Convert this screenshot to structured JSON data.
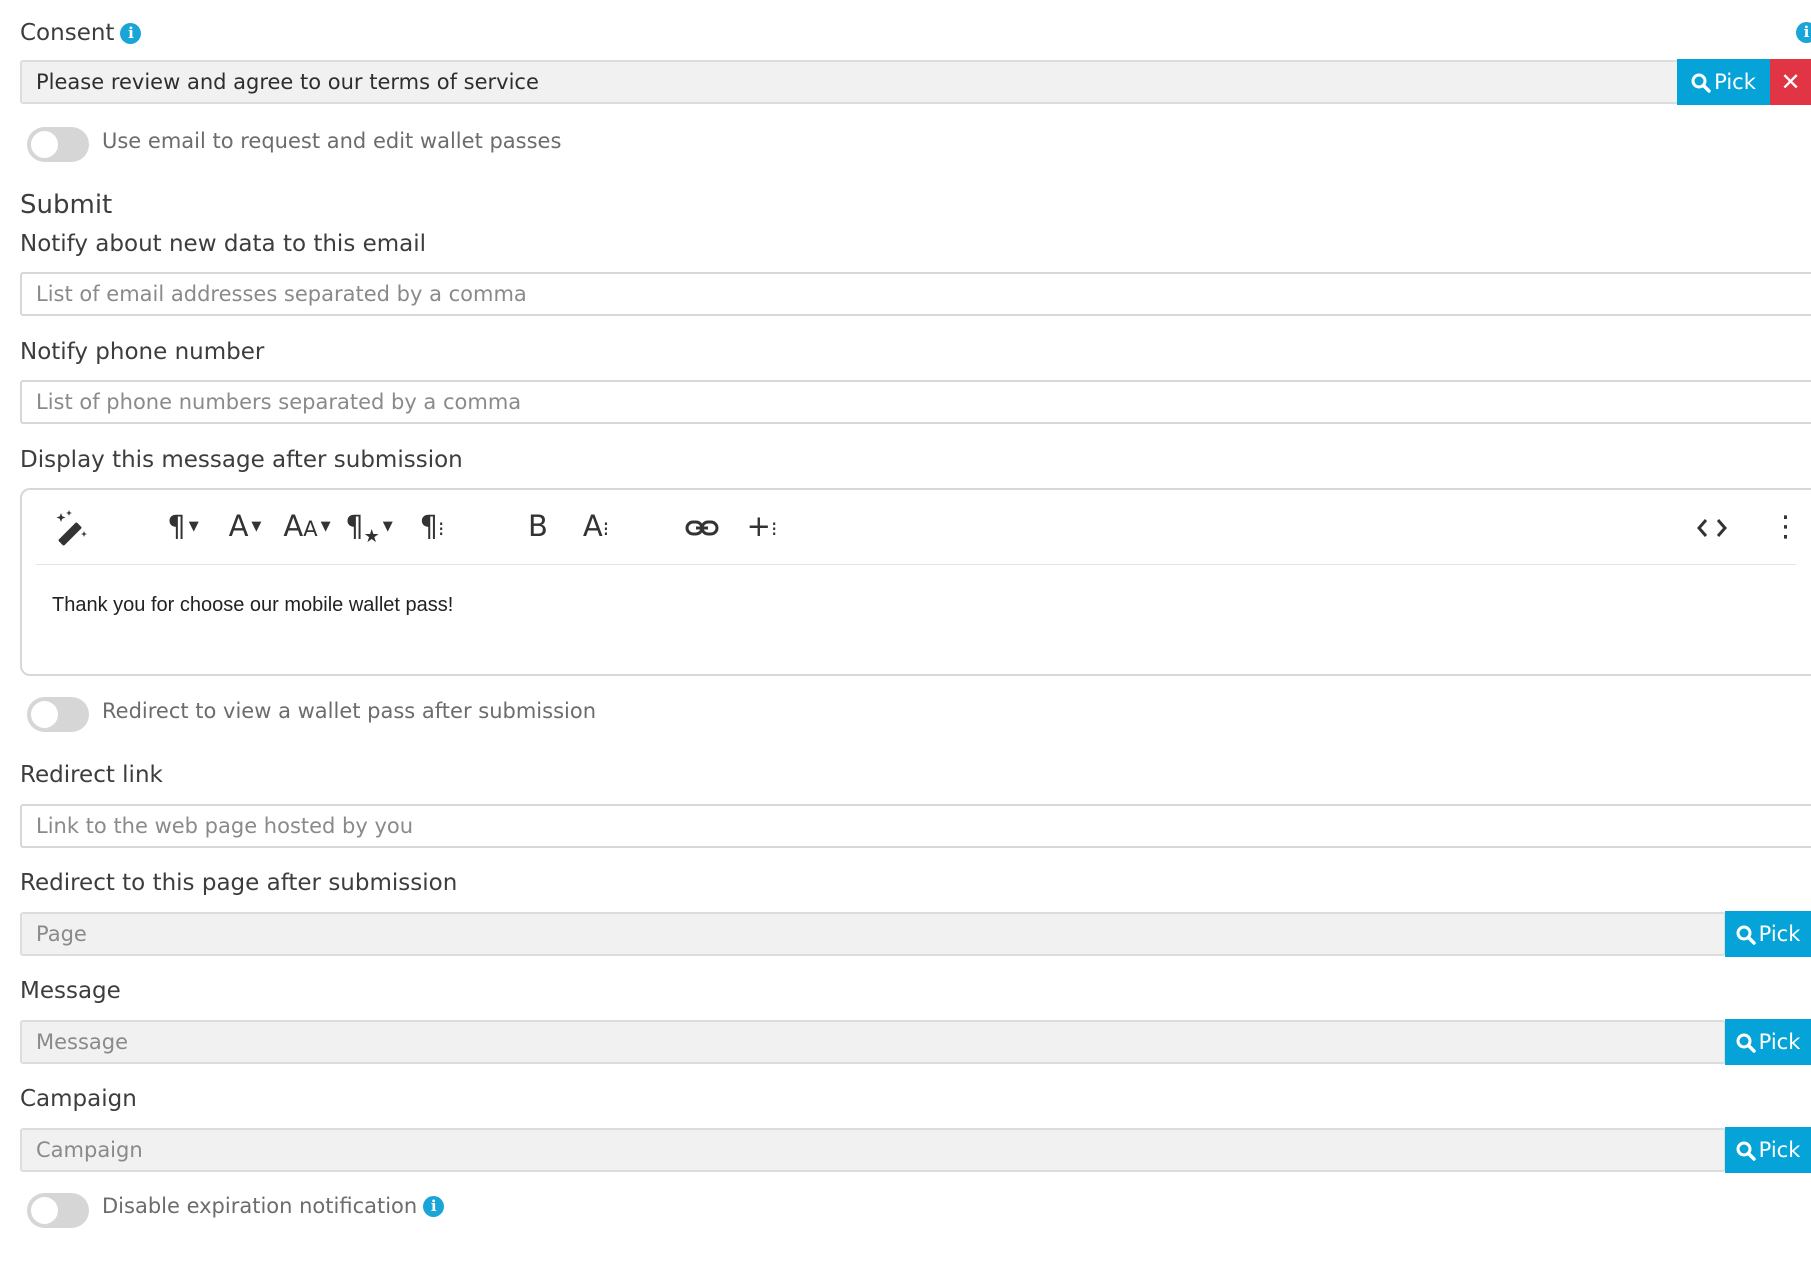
{
  "consent": {
    "label": "Consent",
    "value": "Please review and agree to our terms of service",
    "pick_label": "Pick",
    "clear_label": "✕"
  },
  "email_edit_toggle": {
    "label": "Use email to request and edit wallet passes",
    "on": false
  },
  "submit": {
    "title": "Submit",
    "notify_email": {
      "label": "Notify about new data to this email",
      "placeholder": "List of email addresses separated by a comma"
    },
    "notify_phone": {
      "label": "Notify phone number",
      "placeholder": "List of phone numbers separated by a comma"
    },
    "message_editor": {
      "label": "Display this message after submission",
      "content": "Thank you for choose our mobile wallet pass!",
      "toolbar": [
        "magic-wand-icon",
        "paragraph-format-icon",
        "font-family-icon",
        "font-size-icon",
        "paragraph-style-icon",
        "paragraph-more-icon",
        "bold-icon",
        "text-more-icon",
        "insert-link-icon",
        "insert-more-icon",
        "code-view-icon",
        "more-vertical-icon"
      ]
    },
    "redirect_toggle": {
      "label": "Redirect to view a wallet pass after submission",
      "on": false
    },
    "redirect_link": {
      "label": "Redirect link",
      "placeholder": "Link to the web page hosted by you"
    },
    "redirect_page": {
      "label": "Redirect to this page after submission",
      "placeholder": "Page",
      "pick_label": "Pick"
    },
    "message": {
      "label": "Message",
      "placeholder": "Message",
      "pick_label": "Pick"
    },
    "campaign": {
      "label": "Campaign",
      "placeholder": "Campaign",
      "pick_label": "Pick"
    },
    "disable_expiration": {
      "label": "Disable expiration notification",
      "on": false
    }
  },
  "colors": {
    "accent": "#06a3d8",
    "danger": "#e13546",
    "toggle_off": "#d6d6d6"
  }
}
